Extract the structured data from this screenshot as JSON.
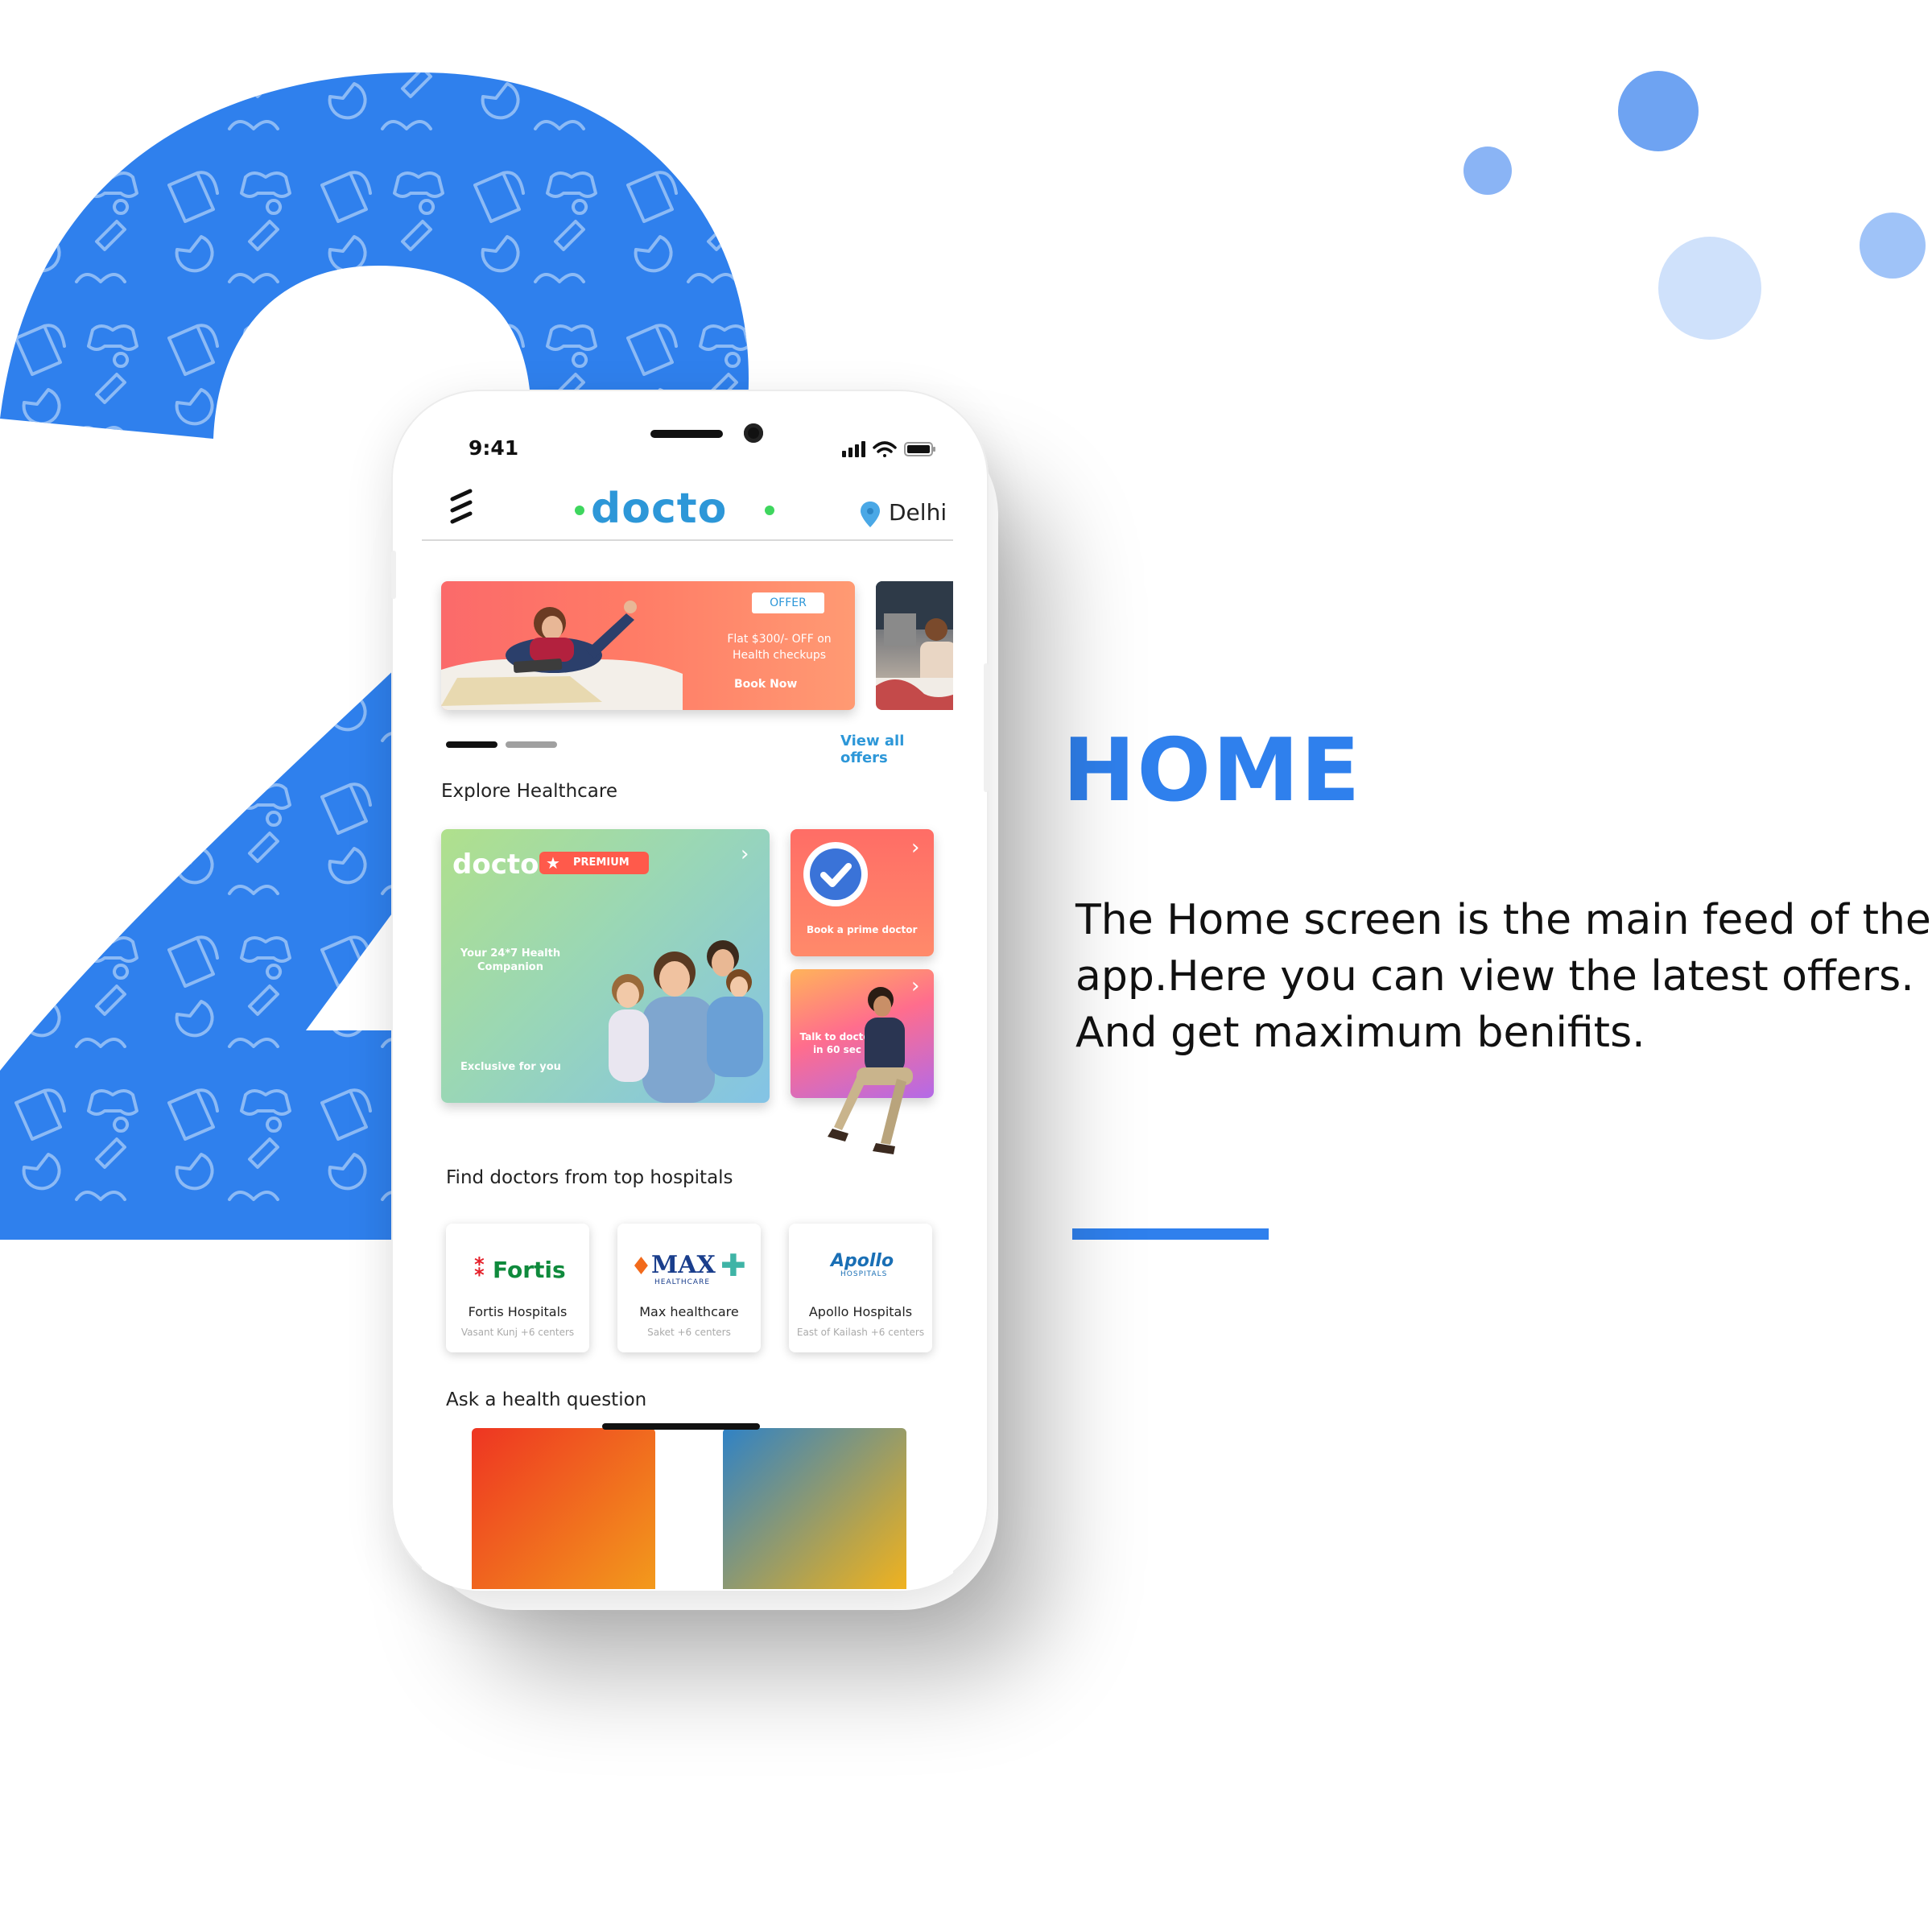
{
  "colors": {
    "accent_blue": "#2f80ed",
    "brand_blue": "#2d97d8",
    "brand_green": "#3ed65e",
    "offer_coral": "#ff7b66",
    "premium_badge": "#ff5a4b"
  },
  "slide": {
    "title": "HOME",
    "description": [
      "The Home screen is the main feed of the",
      "app.Here you can view the latest offers.",
      "And get maximum benifits."
    ]
  },
  "phone": {
    "status_time": "9:41",
    "status_icons": [
      "signal-icon",
      "wifi-icon",
      "battery-icon"
    ],
    "header": {
      "menu_icon": "menu-icon",
      "brand": "docto",
      "location_icon": "location-pin-icon",
      "location": "Delhi"
    },
    "offers": {
      "tag": "OFFER",
      "text": "Flat $300/- OFF on Health checkups",
      "cta": "Book Now",
      "view_all": "View all offers"
    },
    "explore": {
      "title": "Explore Healthcare",
      "premium": {
        "logo": "docto",
        "badge": "PREMIUM",
        "subtitle": "Your 24*7 Health Companion",
        "footer": "Exclusive for you"
      },
      "prime": {
        "label": "Book a prime doctor",
        "icon": "verified-check-icon"
      },
      "talk": {
        "label": "Talk to doctor in 60 sec"
      }
    },
    "hospitals": {
      "title": "Find doctors from top hospitals",
      "items": [
        {
          "logo": "Fortis",
          "name": "Fortis Hospitals",
          "sub": "Vasant Kunj +6 centers"
        },
        {
          "logo": "MAX",
          "logo_sub": "HEALTHCARE",
          "name": "Max healthcare",
          "sub": "Saket +6 centers"
        },
        {
          "logo": "Apollo",
          "logo_sub": "HOSPITALS",
          "name": "Apollo Hospitals",
          "sub": "East of Kailash +6 centers"
        }
      ]
    },
    "questions": {
      "title": "Ask a health question"
    }
  }
}
